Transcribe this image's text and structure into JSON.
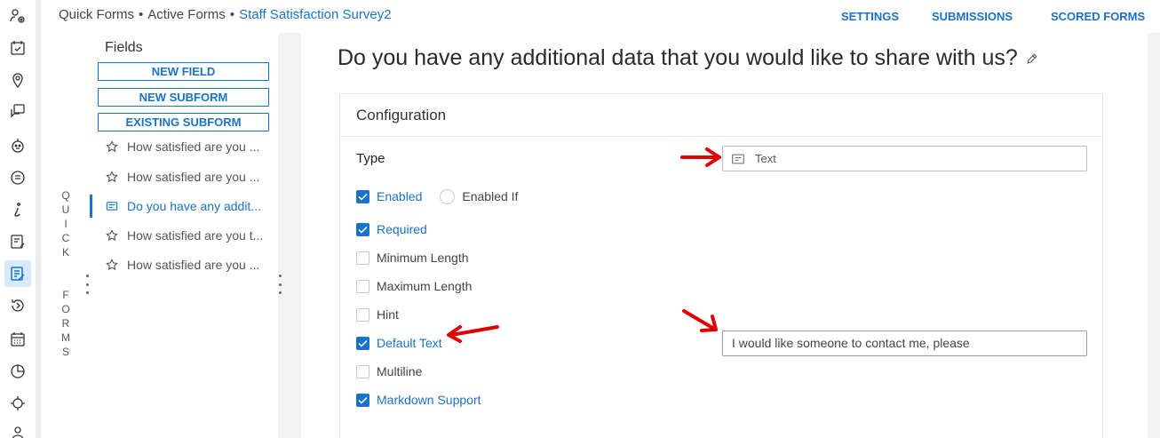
{
  "breadcrumb": {
    "items": [
      "Quick Forms",
      "Active Forms"
    ],
    "separator": "•",
    "current": "Staff Satisfaction Survey2"
  },
  "top_nav": {
    "settings": "SETTINGS",
    "submissions": "SUBMISSIONS",
    "scored_forms": "SCORED FORMS"
  },
  "quick_forms_label": [
    "Q",
    "U",
    "I",
    "C",
    "K",
    "F",
    "O",
    "R",
    "M",
    "S"
  ],
  "fields_panel": {
    "title": "Fields",
    "buttons": {
      "new_field": "NEW FIELD",
      "new_subform": "NEW SUBFORM",
      "existing_subform": "EXISTING SUBFORM"
    },
    "items": [
      {
        "label": "How satisfied are you ...",
        "icon": "star-icon"
      },
      {
        "label": "How satisfied are you ...",
        "icon": "star-icon"
      },
      {
        "label": "Do you have any addit...",
        "icon": "text-field-icon",
        "selected": true
      },
      {
        "label": "How satisfied are you t...",
        "icon": "star-icon"
      },
      {
        "label": "How satisfied are you ...",
        "icon": "star-icon"
      }
    ]
  },
  "main": {
    "question_title": "Do you have any additional data that you would like to share with us?",
    "config": {
      "heading": "Configuration",
      "type_label": "Type",
      "type_value": "Text",
      "enabled": {
        "label": "Enabled",
        "checked": true
      },
      "enabled_if": "Enabled If",
      "required": {
        "label": "Required",
        "checked": true
      },
      "minimum_length": {
        "label": "Minimum Length",
        "checked": false
      },
      "maximum_length": {
        "label": "Maximum Length",
        "checked": false
      },
      "hint": {
        "label": "Hint",
        "checked": false
      },
      "default_text": {
        "label": "Default Text",
        "checked": true,
        "value": "I would like someone to contact me, please"
      },
      "multiline": {
        "label": "Multiline",
        "checked": false
      },
      "markdown_support": {
        "label": "Markdown Support",
        "checked": true
      }
    }
  },
  "colors": {
    "accent": "#1a73c8",
    "annotation_arrow": "#e00000"
  }
}
